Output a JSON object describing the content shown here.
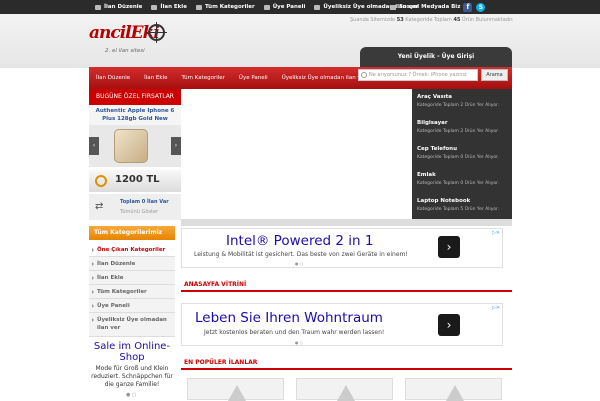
{
  "topbar": {
    "nav": [
      "İlan Düzenle",
      "İlan Ekle",
      "Tüm Kategoriler",
      "Üye Paneli",
      "Üyeliksiz Üye olmadan ilan ver"
    ],
    "social_label": "Sosyal Medyada Biz"
  },
  "stats": {
    "prefix": "Şuanda Sitemizde",
    "count1": "53",
    "middle": "Kategoride Toplam",
    "count2": "45",
    "suffix": "Ürün Bulunmaktadır."
  },
  "header": {
    "logo": "ancilEki",
    "tagline": "2. el ilan sitesi",
    "member": "Yeni Üyelik - Üye Girişi"
  },
  "mainnav": [
    "İlan Düzenle",
    "İlan Ekle",
    "Tüm Kategoriler",
    "Üye Paneli",
    "Üyeliksiz Üye olmadan ilan ver"
  ],
  "search": {
    "placeholder": "Ne arıyorsunuz ? Örnek: iPhone yazınız",
    "button": "Arama"
  },
  "deal": {
    "heading": "BUGÜNE ÖZEL FIRSATLAR",
    "title": "Authentic Apple Iphone 6 Plus 128gb Gold New",
    "price": "1200 TL"
  },
  "total": {
    "line1": "Toplam 0 İlan Var",
    "line2": "Tümünü Göster"
  },
  "categories_dark": [
    {
      "name": "Araç Vasıta",
      "count": "Kategoride Toplam 2 Ürün Yer Alıyor."
    },
    {
      "name": "Bilgisayar",
      "count": "Kategoride Toplam 2 Ürün Yer Alıyor."
    },
    {
      "name": "Cep Telefonu",
      "count": "Kategoride Toplam 0 Ürün Yer Alıyor."
    },
    {
      "name": "Emlak",
      "count": "Kategoride Toplam 0 Ürün Yer Alıyor."
    },
    {
      "name": "Laptop Notebook",
      "count": "Kategoride Toplam 5 Ürün Yer Alıyor."
    }
  ],
  "sidebar": {
    "heading": "Tüm Kategorilerimiz",
    "items": [
      "Öne Çıkan Kategoriler",
      "İlan Düzenle",
      "İlan Ekle",
      "Tüm Kategoriler",
      "Üye Paneli",
      "Üyeliksiz Üye olmadan ilan ver"
    ]
  },
  "ad1": {
    "headline": "Intel® Powered 2 in 1",
    "subline": "Leistung & Mobilität ist gesichert. Das beste von zwei Geräte in einem!"
  },
  "section1": "ANASAYFA VİTRİNİ",
  "ad2": {
    "headline": "Leben Sie Ihren Wohntraum",
    "subline": "Jetzt kostenlos beraten und den Traum wahr werden lassen!"
  },
  "section2": "EN POPÜLER İLANLAR",
  "left_ad": {
    "headline": "Sale im Online-Shop",
    "subline": "Mode für Groß und Klein reduziert. Schnäppchen für die ganze Familie!"
  }
}
